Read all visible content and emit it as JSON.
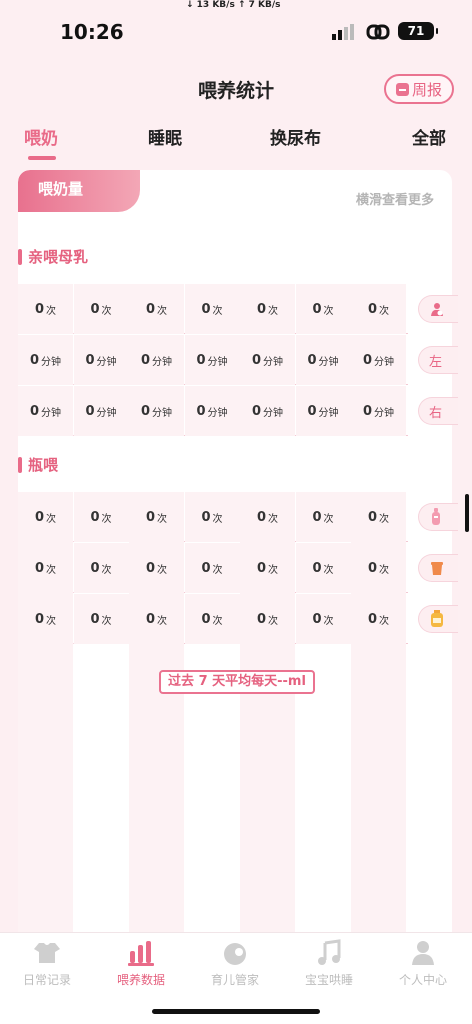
{
  "status": {
    "time": "10:26",
    "net": "↓ 13 KB/s   ↑ 7 KB/s",
    "battery": "71"
  },
  "header": {
    "title": "喂养统计",
    "weekly_label": "周报"
  },
  "tabs": [
    "喂奶",
    "睡眠",
    "换尿布",
    "全部"
  ],
  "card": {
    "title": "喂奶量",
    "hint": "横滑查看更多"
  },
  "breastfeeding": {
    "label": "亲喂母乳",
    "rows": [
      {
        "values": [
          "0",
          "0",
          "0",
          "0",
          "0",
          "0",
          "0"
        ],
        "unit": "次",
        "tag_icon": "mother-baby-icon",
        "tag": ""
      },
      {
        "values": [
          "0",
          "0",
          "0",
          "0",
          "0",
          "0",
          "0"
        ],
        "unit": "分钟",
        "tag": "左"
      },
      {
        "values": [
          "0",
          "0",
          "0",
          "0",
          "0",
          "0",
          "0"
        ],
        "unit": "分钟",
        "tag": "右"
      }
    ]
  },
  "bottle": {
    "label": "瓶喂",
    "rows": [
      {
        "values": [
          "0",
          "0",
          "0",
          "0",
          "0",
          "0",
          "0"
        ],
        "unit": "次",
        "tag_icon": "baby-bottle-icon"
      },
      {
        "values": [
          "0",
          "0",
          "0",
          "0",
          "0",
          "0",
          "0"
        ],
        "unit": "次",
        "tag_icon": "cup-icon"
      },
      {
        "values": [
          "0",
          "0",
          "0",
          "0",
          "0",
          "0",
          "0"
        ],
        "unit": "次",
        "tag_icon": "jar-icon"
      }
    ]
  },
  "average_label": "过去 7 天平均每天--ml",
  "nav": [
    "日常记录",
    "喂养数据",
    "育儿管家",
    "宝宝哄睡",
    "个人中心"
  ],
  "colors": {
    "accent": "#e96b89",
    "background": "#fdeff2"
  }
}
